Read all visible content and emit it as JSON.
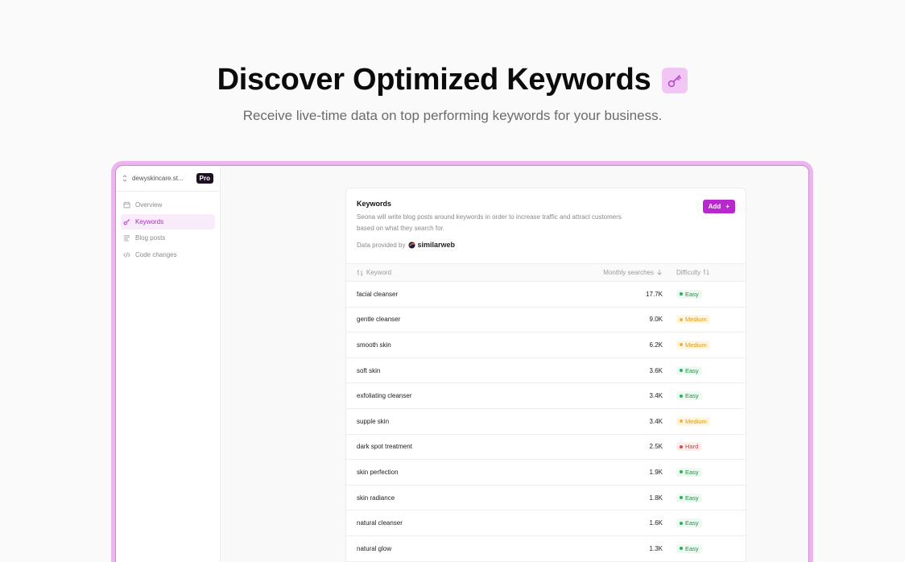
{
  "hero": {
    "title": "Discover Optimized Keywords",
    "icon": "key-icon",
    "subtitle": "Receive live-time data on top performing keywords for your business."
  },
  "sidebar": {
    "workspace": "dewyskincare.st...",
    "plan_badge": "Pro",
    "items": [
      {
        "label": "Overview",
        "icon": "calendar-icon",
        "active": false
      },
      {
        "label": "Keywords",
        "icon": "key-icon",
        "active": true
      },
      {
        "label": "Blog posts",
        "icon": "lines-icon",
        "active": false
      },
      {
        "label": "Code changes",
        "icon": "code-icon",
        "active": false
      }
    ]
  },
  "card": {
    "title": "Keywords",
    "description": "Seona will write blog posts around keywords in order to increase traffic and attract customers based on what they search for.",
    "provider_label": "Data provided by",
    "provider_name": "similarweb",
    "add_button": "Add",
    "columns": {
      "keyword": "Keyword",
      "monthly": "Monthly searches",
      "difficulty": "Difficulty"
    },
    "rows": [
      {
        "keyword": "facial cleanser",
        "monthly": "17.7K",
        "difficulty": "Easy"
      },
      {
        "keyword": "gentle cleanser",
        "monthly": "9.0K",
        "difficulty": "Medium"
      },
      {
        "keyword": "smooth skin",
        "monthly": "6.2K",
        "difficulty": "Medium"
      },
      {
        "keyword": "soft skin",
        "monthly": "3.6K",
        "difficulty": "Easy"
      },
      {
        "keyword": "exfoliating cleanser",
        "monthly": "3.4K",
        "difficulty": "Easy"
      },
      {
        "keyword": "supple skin",
        "monthly": "3.4K",
        "difficulty": "Medium"
      },
      {
        "keyword": "dark spot treatment",
        "monthly": "2.5K",
        "difficulty": "Hard"
      },
      {
        "keyword": "skin perfection",
        "monthly": "1.9K",
        "difficulty": "Easy"
      },
      {
        "keyword": "skin radiance",
        "monthly": "1.8K",
        "difficulty": "Easy"
      },
      {
        "keyword": "natural cleanser",
        "monthly": "1.6K",
        "difficulty": "Easy"
      },
      {
        "keyword": "natural glow",
        "monthly": "1.3K",
        "difficulty": "Easy"
      }
    ]
  },
  "colors": {
    "accent": "#b928cf",
    "frame": "#ecb4f0",
    "easy": "#22b35a",
    "medium": "#f4b23a",
    "hard": "#e14545"
  }
}
